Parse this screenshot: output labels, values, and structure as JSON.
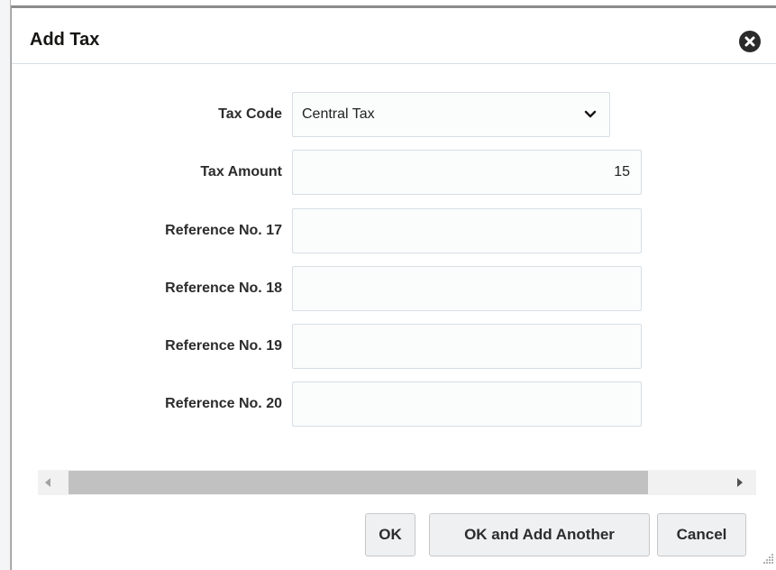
{
  "dialog": {
    "title": "Add Tax",
    "close_icon": "close-circle-icon"
  },
  "form": {
    "tax_code": {
      "label": "Tax Code",
      "selected": "Central Tax"
    },
    "tax_amount": {
      "label": "Tax Amount",
      "value": "15"
    },
    "ref17": {
      "label": "Reference No. 17",
      "value": ""
    },
    "ref18": {
      "label": "Reference No. 18",
      "value": ""
    },
    "ref19": {
      "label": "Reference No. 19",
      "value": ""
    },
    "ref20": {
      "label": "Reference No. 20",
      "value": ""
    }
  },
  "buttons": {
    "ok": "OK",
    "ok_add_another": "OK and Add Another",
    "cancel": "Cancel"
  },
  "colors": {
    "field_border": "#d6dfe6",
    "button_bg": "#eef0f2",
    "scroll_thumb": "#c1c1c1"
  }
}
